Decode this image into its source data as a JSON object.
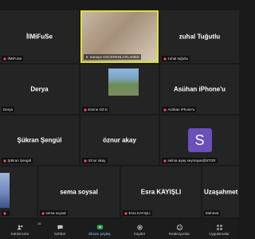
{
  "tiles": [
    {
      "center": "İlMiFuSe",
      "corner": "İlMiFuSe"
    },
    {
      "center": "",
      "corner": "Sanaya OZCERENLARLAMEE"
    },
    {
      "center": "zuhal Tuğutlu",
      "corner": "zuhal tuğutlu"
    },
    {
      "center": "Derya",
      "corner": "Derya"
    },
    {
      "center": "",
      "corner": "Emine OZ.K"
    },
    {
      "center": "Asühan iPhone'u",
      "corner": "Aslıhan iPhone'u"
    },
    {
      "center": "Şükran Şengül",
      "corner": "Şükran Şengül"
    },
    {
      "center": "öznur akay",
      "corner": "öznur akay"
    },
    {
      "center": "S",
      "corner": "selma ayaş seymayar@5TOR"
    },
    {
      "center": "",
      "corner": ""
    },
    {
      "center": "sema soysal",
      "corner": "sema soysal"
    },
    {
      "center": "Esra KAYIŞLI",
      "corner": "Esra KAYIŞLI"
    },
    {
      "center": "Uzaşahmet",
      "corner": "Mehmet"
    }
  ],
  "toolbar": {
    "participants": {
      "label": "Katılımcılar",
      "count": "16"
    },
    "chat": {
      "label": "Sohbet"
    },
    "share": {
      "label": "Ekranı paylaş"
    },
    "record": {
      "label": "Kaydet"
    },
    "reactions": {
      "label": "Reaksiyonlar"
    },
    "apps": {
      "label": "Uygulamalar"
    }
  },
  "colors": {
    "speaking_border": "#d8e234",
    "avatar": "#6b4fbb",
    "share_accent": "#7ec8ff"
  }
}
